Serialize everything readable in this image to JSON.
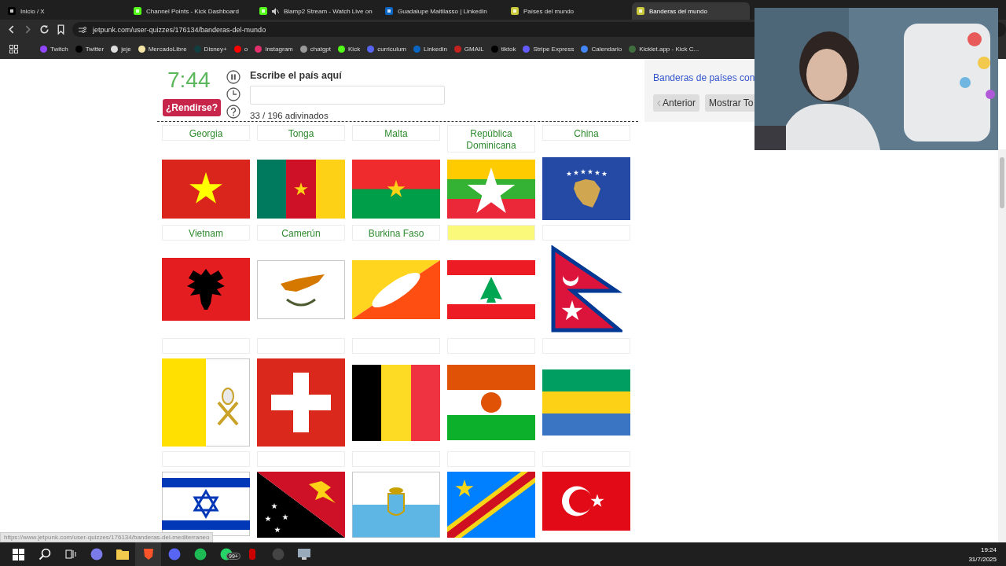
{
  "browser": {
    "tabs": [
      {
        "title": "Inicio / X",
        "selected": false,
        "muted": false
      },
      {
        "title": "Channel Points - Kick Dashboard",
        "selected": false,
        "muted": false
      },
      {
        "title": "Blamp2 Stream - Watch Live on",
        "selected": false,
        "muted": true
      },
      {
        "title": "Guadalupe Maitilasso | LinkedIn",
        "selected": false,
        "muted": false
      },
      {
        "title": "Países del mundo",
        "selected": false,
        "muted": false
      },
      {
        "title": "Banderas del mundo",
        "selected": true,
        "muted": false
      }
    ],
    "url": "jetpunk.com/user-quizzes/176134/banderas-del-mundo",
    "bookmarks": [
      "Twitch",
      "Twitter",
      "jeje",
      "MercadoLibre",
      "Disney+",
      "o",
      "Instagram",
      "chatgpt",
      "Kick",
      "curriculum",
      "Linkedin",
      "GMAIL",
      "tiktok",
      "Stripe Express",
      "Calendario",
      "Kicklet.app - Kick C..."
    ]
  },
  "quiz": {
    "timer": "7:44",
    "give_up_button": "¿Rendirse?",
    "prompt": "Escribe el país aquí",
    "progress": "33 / 196 adivinados",
    "answer_rows": [
      [
        {
          "label": "Georgia",
          "selected": false
        },
        {
          "label": "Tonga",
          "selected": false
        },
        {
          "label": "Malta",
          "selected": false
        },
        {
          "label": "República Dominicana",
          "selected": false
        },
        {
          "label": "China",
          "selected": false
        }
      ],
      [
        {
          "label": "Vietnam",
          "selected": false
        },
        {
          "label": "Camerún",
          "selected": false
        },
        {
          "label": "Burkina Faso",
          "selected": false
        },
        {
          "selected": true
        },
        {
          "selected": false
        }
      ],
      [
        {
          "selected": false
        },
        {
          "selected": false
        },
        {
          "selected": false
        },
        {
          "selected": false
        },
        {
          "selected": false
        }
      ],
      [
        {
          "selected": false
        },
        {
          "selected": false
        },
        {
          "selected": false
        },
        {
          "selected": false
        },
        {
          "selected": false
        }
      ]
    ]
  },
  "side_panel": {
    "link": "Banderas de países con",
    "buttons": [
      "Anterior",
      "Mostrar To"
    ]
  },
  "status_url": "https://www.jetpunk.com/user-quizzes/176134/banderas-del-mediterraneo",
  "taskbar": {
    "notification_badge": "99+",
    "time": "19:24",
    "date": "31/7/2025"
  }
}
